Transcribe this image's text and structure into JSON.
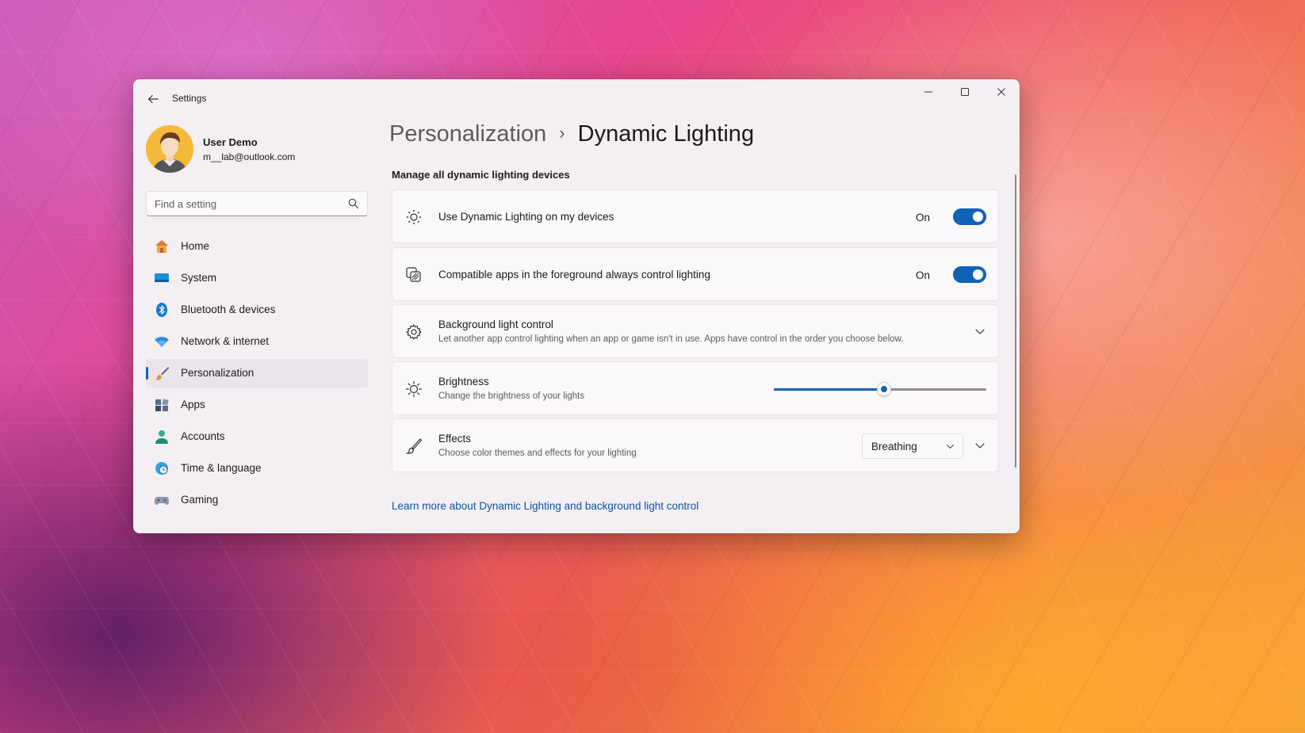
{
  "window": {
    "title": "Settings",
    "controls": {
      "minimize": "minimize-icon",
      "maximize": "maximize-icon",
      "close": "close-icon"
    }
  },
  "profile": {
    "name": "User Demo",
    "email": "m__lab@outlook.com"
  },
  "search": {
    "placeholder": "Find a setting",
    "value": ""
  },
  "sidebar": {
    "items": [
      {
        "label": "Home",
        "icon": "home-icon"
      },
      {
        "label": "System",
        "icon": "system-icon"
      },
      {
        "label": "Bluetooth & devices",
        "icon": "bluetooth-icon"
      },
      {
        "label": "Network & internet",
        "icon": "wifi-icon"
      },
      {
        "label": "Personalization",
        "icon": "brush-icon",
        "active": true
      },
      {
        "label": "Apps",
        "icon": "apps-icon"
      },
      {
        "label": "Accounts",
        "icon": "accounts-icon"
      },
      {
        "label": "Time & language",
        "icon": "globe-clock-icon"
      },
      {
        "label": "Gaming",
        "icon": "gamepad-icon"
      }
    ]
  },
  "breadcrumb": {
    "parent": "Personalization",
    "separator": "›",
    "current": "Dynamic Lighting"
  },
  "content": {
    "section_title": "Manage all dynamic lighting devices",
    "cards": {
      "use_dynamic": {
        "title": "Use Dynamic Lighting on my devices",
        "state": "On",
        "icon": "sun-dots-icon"
      },
      "compatible_apps": {
        "title": "Compatible apps in the foreground always control lighting",
        "state": "On",
        "icon": "apps-stack-icon"
      },
      "background_control": {
        "title": "Background light control",
        "subtitle": "Let another app control lighting when an app or game isn't in use. Apps have control in the order you choose below.",
        "icon": "gear-icon"
      },
      "brightness": {
        "title": "Brightness",
        "subtitle": "Change the brightness of your lights",
        "icon": "brightness-icon",
        "value_percent": 52
      },
      "effects": {
        "title": "Effects",
        "subtitle": "Choose color themes and effects for your lighting",
        "icon": "brush-outline-icon",
        "selected": "Breathing"
      }
    },
    "learn_more": "Learn more about Dynamic Lighting and background light control"
  },
  "colors": {
    "accent": "#0f62b8",
    "link": "#0a53a5",
    "window_bg": "#f4eff3",
    "card_bg": "#faf8fa"
  }
}
